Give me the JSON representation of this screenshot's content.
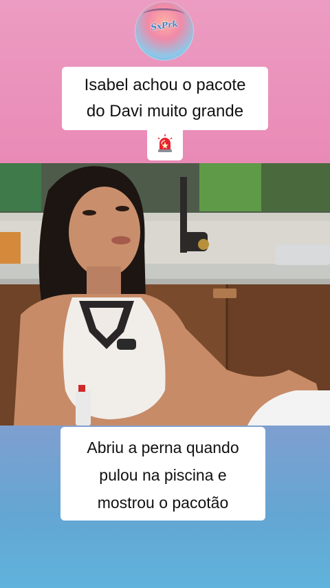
{
  "logo": {
    "text": "SxPrk"
  },
  "caption_top": {
    "line1": "Isabel achou o pacote",
    "line2": "do Davi muito grande"
  },
  "alert_icon": "police-siren-icon",
  "caption_bottom": {
    "line1": "Abriu a perna quando",
    "line2": "pulou na piscina e",
    "line3": "mostrou o pacotão"
  },
  "colors": {
    "top_background": "#ec9cc2",
    "bottom_background": "#64a6d3",
    "caption_background": "#ffffff"
  }
}
